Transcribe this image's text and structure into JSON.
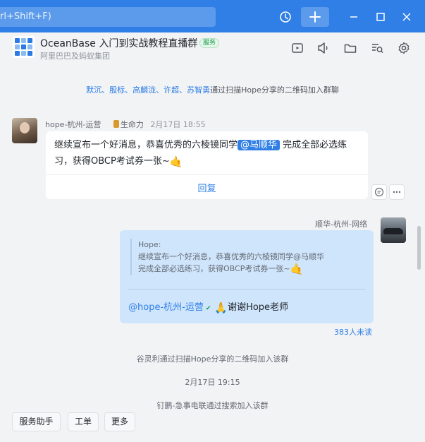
{
  "titlebar": {
    "search_placeholder": "rl+Shift+F)",
    "icons": [
      "history-icon",
      "plus-icon",
      "minimize-icon",
      "maximize-icon",
      "close-icon"
    ],
    "accent": "#2f7fe6"
  },
  "header": {
    "group_name": "OceanBase 入门到实战教程直播群",
    "badge": "服务",
    "org": "阿里巴巴及蚂蚁集团",
    "icons": [
      "video-icon",
      "speaker-icon",
      "folder-icon",
      "search-history-icon",
      "settings-icon"
    ]
  },
  "system_join_blue": {
    "names": "默沉、殷标、高麟泷、许超、苏智勇",
    "text": "通过扫描Hope分享的二维码加入群聊"
  },
  "message1": {
    "sender": "hope-杭州-运营",
    "vitality": "生命力",
    "time": "2月17日 18:55",
    "text_part1": "继续宣布一个好消息，恭喜优秀的六棱镜同学",
    "mention": "@马顺华",
    "text_part2": "完成全部必选练习，获得OBCP考试券一张~",
    "emoji": "🤙",
    "reply_label": "回复"
  },
  "message2": {
    "sender": "顺华-杭州-网络",
    "quote_author": "Hope:",
    "quote_line1": "继续宣布一个好消息，恭喜优秀的六棱镜同学@马顺华",
    "quote_line2": "完成全部必选练习，获得OBCP考试券一张~",
    "quote_emoji": "🤙",
    "at_name": "@hope-杭州-运营",
    "reply_emoji": "🙏",
    "reply_text": "谢谢Hope老师",
    "unread": "383人未读"
  },
  "system_join2": "谷灵利通过扫描Hope分享的二维码加入该群",
  "date_separator": "2月17日 19:15",
  "system_join3": "钉鹏-急事电联通过搜索加入该群",
  "bottom_buttons": [
    "服务助手",
    "工单",
    "更多"
  ]
}
